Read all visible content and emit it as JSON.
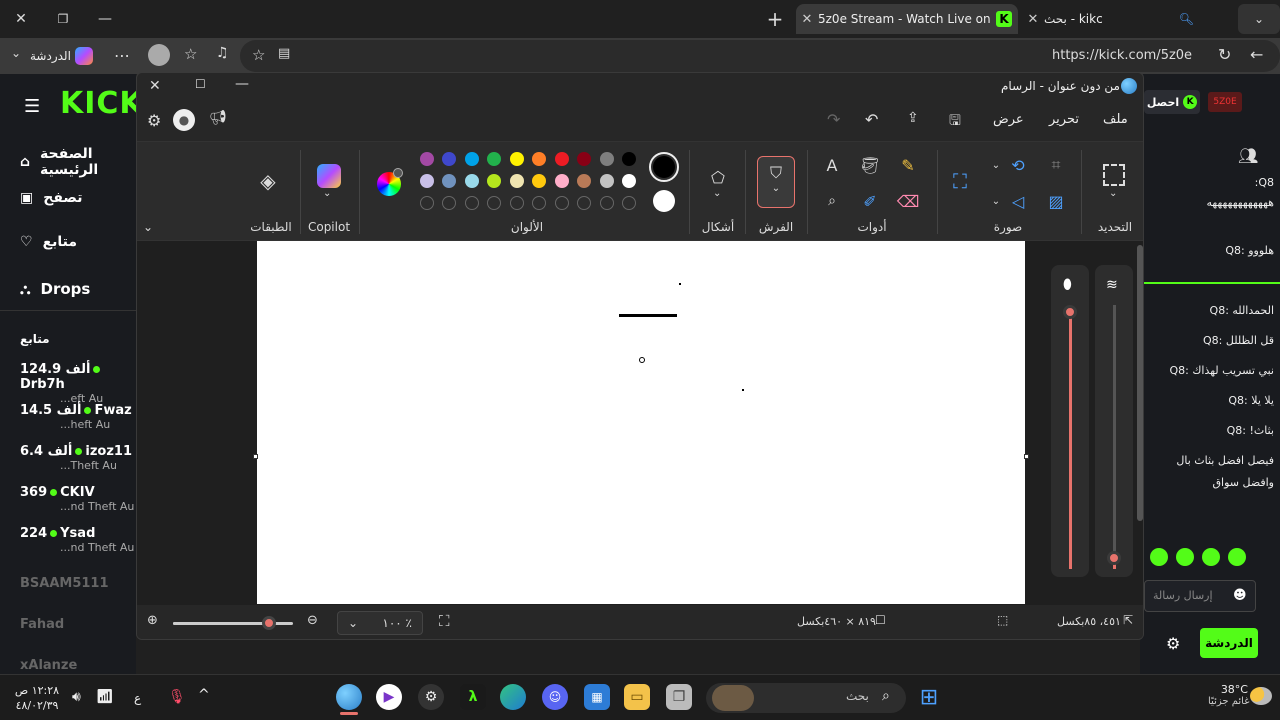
{
  "browser": {
    "tabs": [
      {
        "label": "5z0e Stream - Watch Live on Kick",
        "active": true
      },
      {
        "label": "بحث - kikc",
        "active": false
      }
    ],
    "address": "https://kick.com/5z0e",
    "chat_button": "الدردشة"
  },
  "kick": {
    "logo": "KICK",
    "nav": [
      {
        "label": "الصفحة الرئيسية",
        "icon": "home-icon"
      },
      {
        "label": "تصفح",
        "icon": "browse-icon"
      },
      {
        "label": "متابع",
        "icon": "heart-icon"
      },
      {
        "label": "Drops",
        "icon": "drops-icon"
      }
    ],
    "following_title": "متابع",
    "following": [
      {
        "name": "Drb7h",
        "count": "124.9 ألف",
        "game": "...eft Au"
      },
      {
        "name": "Fwaz",
        "count": "14.5 ألف",
        "game": "...heft Au"
      },
      {
        "name": "izoz11",
        "count": "6.4 ألف",
        "game": "...Theft Au"
      },
      {
        "name": "CKIV",
        "count": "369",
        "game": "...nd Theft Au"
      },
      {
        "name": "Ysad",
        "count": "224",
        "game": "...nd Theft Au"
      }
    ],
    "offline": [
      "BSAAM5111",
      "Fahad",
      "xAlanze"
    ],
    "chat": {
      "header_button": "احصل",
      "lines": [
        "Q8:",
        "ههههههههههههه",
        "هلووو :Q8",
        "الحمدالله :Q8",
        "قل الظللل :Q8",
        "نبي تسريب لهذاك :Q8",
        "يلا يلا :Q8",
        "بثاث! :Q8",
        "فيصل افضل بثاث بال",
        "وافضل سواق"
      ],
      "input_placeholder": "إرسال رسالة",
      "send_button": "الدردشة"
    }
  },
  "paint": {
    "title": "من دون عنوان - الرسام",
    "menu": [
      "ملف",
      "تحرير",
      "عرض"
    ],
    "ribbon_labels": {
      "selection": "التحديد",
      "image": "صورة",
      "tools": "أدوات",
      "brushes": "الفرش",
      "shapes": "أشكال",
      "colors": "الألوان",
      "copilot": "Copilot",
      "layers": "الطبقات"
    },
    "palette_row1": [
      "#000000",
      "#7f7f7f",
      "#880015",
      "#ed1c24",
      "#ff7f27",
      "#fff200",
      "#22b14c",
      "#00a2e8",
      "#3f48cc",
      "#a349a4"
    ],
    "palette_row2": [
      "#ffffff",
      "#c3c3c3",
      "#b97a57",
      "#ffaec9",
      "#ffc90e",
      "#efe4b0",
      "#b5e61d",
      "#99d9ea",
      "#7092be",
      "#c8bfe7"
    ],
    "primary_color": "#000000",
    "secondary_color": "#ffffff",
    "accent": "#e8736c",
    "status": {
      "cursor_pos": "٤٥١، ٨٥بكسل",
      "canvas_size": "٨١٩ × ٤٦٠بكسل",
      "zoom": "١٠٠ ٪",
      "zoom_level": 0.8
    }
  },
  "taskbar": {
    "weather_temp": "38°C",
    "weather_desc": "غائم جزئيًا",
    "search_placeholder": "بحث",
    "time": "١٢:٢٨ ص",
    "date": "٤٨/٠٢/٣٩",
    "lang": "ع"
  }
}
